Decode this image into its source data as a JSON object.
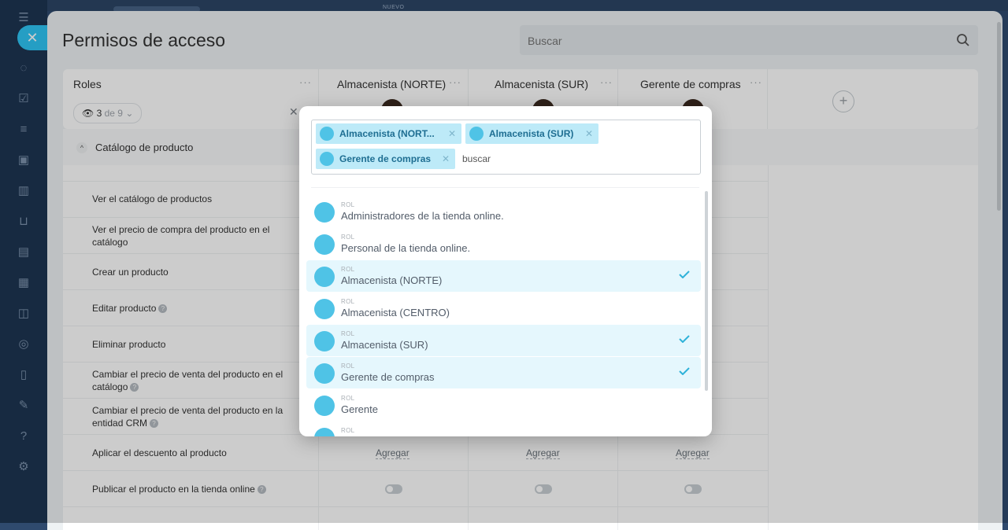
{
  "app": {
    "top_tag": "NUEVO",
    "close_icon": "close-icon",
    "rail_icons": [
      "menu-icon",
      "chat-icon",
      "tasks-icon",
      "funnel-icon",
      "robot-icon",
      "chart-icon",
      "cart-icon",
      "feed-icon",
      "calendar-icon",
      "box-icon",
      "target-icon",
      "doc-icon",
      "sign-icon",
      "help-icon",
      "settings-icon"
    ]
  },
  "page": {
    "title": "Permisos de acceso",
    "search_placeholder": "Buscar"
  },
  "roles_header": {
    "roles_label": "Roles",
    "filter": {
      "count": "3",
      "of_text": "de 9"
    },
    "columns": [
      "Almacenista (NORTE)",
      "Almacenista (SUR)",
      "Gerente de compras"
    ]
  },
  "section": {
    "title": "Catálogo de producto",
    "permissions": [
      "Ver el catálogo de productos",
      "Ver el precio de compra del producto en el catálogo",
      "Crear un producto",
      "Editar producto",
      "Eliminar producto",
      "Cambiar el precio de venta del producto en el catálogo",
      "Cambiar el precio de venta del producto en la entidad CRM",
      "Aplicar el descuento al producto",
      "Publicar el producto en la tienda online"
    ],
    "add_label": "Agregar"
  },
  "dropdown": {
    "tags": [
      "Almacenista (NORT...",
      "Almacenista (SUR)",
      "Gerente de compras"
    ],
    "search_placeholder": "buscar",
    "items": [
      {
        "kind": "ROL",
        "name": "Administradores de la tienda online.",
        "selected": false
      },
      {
        "kind": "ROL",
        "name": "Personal de la tienda online.",
        "selected": false
      },
      {
        "kind": "ROL",
        "name": "Almacenista (NORTE)",
        "selected": true
      },
      {
        "kind": "ROL",
        "name": "Almacenista (CENTRO)",
        "selected": false
      },
      {
        "kind": "ROL",
        "name": "Almacenista (SUR)",
        "selected": true
      },
      {
        "kind": "ROL",
        "name": "Gerente de compras",
        "selected": true
      },
      {
        "kind": "ROL",
        "name": "Gerente",
        "selected": false
      },
      {
        "kind": "ROL",
        "name": "",
        "selected": false
      }
    ]
  },
  "colors": {
    "accent": "#2fc6f6",
    "selected_bg": "#e5f7fd",
    "tag_bg": "#bdeaf8",
    "tag_text": "#1e6e92"
  }
}
